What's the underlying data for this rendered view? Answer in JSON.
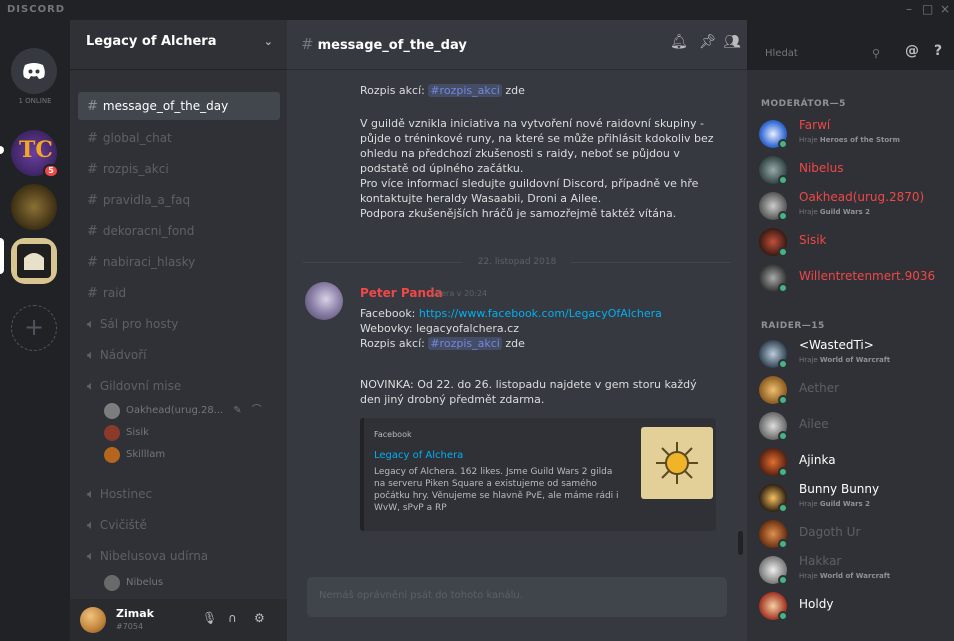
{
  "app": {
    "brand": "DISCORD",
    "win_controls": [
      "–",
      "□",
      "×"
    ]
  },
  "servers": {
    "online_label": "1 ONLINE",
    "badge_count": "5"
  },
  "guild": {
    "name": "Legacy of Alchera"
  },
  "channels": [
    {
      "name": "message_of_the_day",
      "type": "text",
      "active": true
    },
    {
      "name": "global_chat",
      "type": "text"
    },
    {
      "name": "rozpis_akci",
      "type": "text"
    },
    {
      "name": "pravidla_a_faq",
      "type": "text"
    },
    {
      "name": "dekoracni_fond",
      "type": "text"
    },
    {
      "name": "nabiraci_hlasky",
      "type": "text"
    },
    {
      "name": "raid",
      "type": "text"
    },
    {
      "name": "Sál pro hosty",
      "type": "voice"
    },
    {
      "name": "Nádvoří",
      "type": "voice"
    },
    {
      "name": "Gildovní mise",
      "type": "voice"
    },
    {
      "name": "Hostinec",
      "type": "voice"
    },
    {
      "name": "Cvičiště",
      "type": "voice"
    },
    {
      "name": "Nibelusova udírna",
      "type": "voice"
    }
  ],
  "voice_users": {
    "gildovni": [
      "Oakhead(urug.28...",
      "Sisik",
      "Skilllam"
    ],
    "nibelusova": [
      "Nibelus"
    ]
  },
  "user": {
    "name": "Zimak",
    "tag": "#7054"
  },
  "header": {
    "channel": "message_of_the_day",
    "search_placeholder": "Hledat"
  },
  "messages": {
    "top_rozpis": "Rozpis akcí:",
    "top_rozpis_tag": "#rozpis_akci",
    "top_rozpis_after": " zde",
    "paragraph": [
      "V guildě vznikla iniciativa na vytvoření nové raidovní skupiny -",
      "půjde o tréninkové runy, na které se může přihlásit kdokoliv bez",
      "ohledu na předchozí zkušenosti s raidy, neboť se půjdou v",
      "podstatě od úplného začátku.",
      "Pro více informací sledujte guildovní Discord, případně ve hře",
      "kontaktujte heraldy Wasaabii, Droni a Ailee.",
      "Podpora zkušenějších hráčů je samozřejmě taktéž vítána."
    ],
    "date_divider": "22. listopad 2018",
    "author": "Peter Panda",
    "timestamp": "včera v 20:24",
    "facebook_label": "Facebook:",
    "facebook_url": "https://www.facebook.com/LegacyOfAlchera",
    "web_line": "Webovky: legacyofalchera.cz",
    "rozpis": "Rozpis akcí:",
    "rozpis_tag": "#rozpis_akci",
    "rozpis_after": " zde",
    "novinka_1": "NOVINKA: Od 22. do 26. listopadu najdete v gem storu každý",
    "novinka_2": "den jiný drobný předmět zdarma.",
    "embed": {
      "provider": "Facebook",
      "title": "Legacy of Alchera",
      "desc": "Legacy of Alchera. 162 likes. Jsme Guild Wars 2 gilda na serveru Piken Square a existujeme od samého počátku hry. Věnujeme se hlavně PvE, ale máme rádi i WvW, sPvP a RP"
    },
    "input_placeholder": "Nemáš oprávnění psát do tohoto kanálu."
  },
  "members": {
    "moderators_label": "MODERÁTOR—5",
    "raiders_label": "RAIDER—15",
    "moderators": [
      {
        "name": "Farwí",
        "game": "Heroes of the Storm",
        "color": "#f04747"
      },
      {
        "name": "Nibelus",
        "game": "",
        "color": "#f04747"
      },
      {
        "name": "Oakhead(urug.2870)",
        "game": "Guild Wars 2",
        "color": "#f04747"
      },
      {
        "name": "Sisik",
        "game": "",
        "color": "#f04747"
      },
      {
        "name": "Willentretenmert.9036",
        "game": "",
        "color": "#f04747"
      }
    ],
    "raiders": [
      {
        "name": "<WastedTi>",
        "game": "World of Warcraft",
        "color": "#ffffff"
      },
      {
        "name": "Aether",
        "game": "",
        "color": "#5d6066"
      },
      {
        "name": "Ailee",
        "game": "",
        "color": "#5d6066"
      },
      {
        "name": "Ajinka",
        "game": "",
        "color": "#ffffff"
      },
      {
        "name": "Bunny Bunny",
        "game": "Guild Wars 2",
        "color": "#ffffff"
      },
      {
        "name": "Dagoth Ur",
        "game": "",
        "color": "#5d6066"
      },
      {
        "name": "Hakkar",
        "game": "World of Warcraft",
        "color": "#5d6066"
      },
      {
        "name": "Holdy",
        "game": "",
        "color": "#ffffff"
      }
    ],
    "playing_prefix": "Hraje"
  }
}
